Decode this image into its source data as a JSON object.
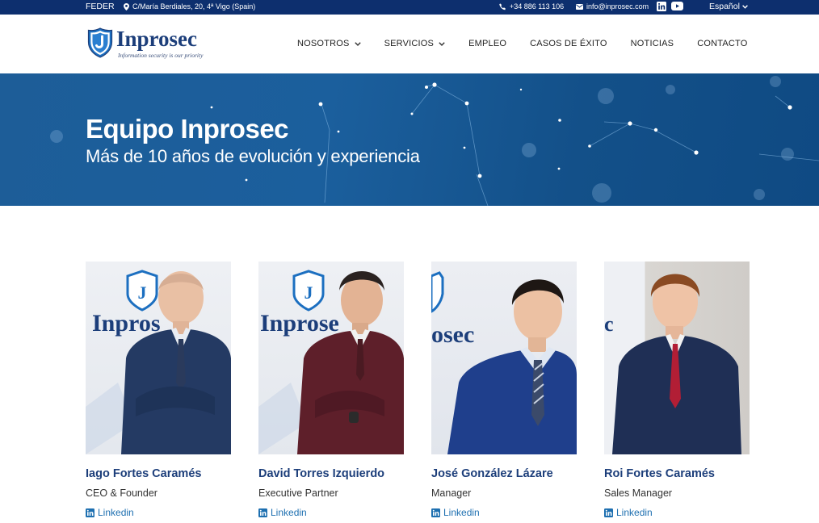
{
  "topbar": {
    "feder": "FEDER",
    "address": "C/María Berdiales, 20, 4ª Vigo (Spain)",
    "phone": "+34 886 113 106",
    "email": "info@inprosec.com",
    "language": "Español"
  },
  "header": {
    "brand": "Inprosec",
    "tagline": "Information security is our priority",
    "nav": [
      {
        "label": "NOSOTROS"
      },
      {
        "label": "SERVICIOS"
      },
      {
        "label": "EMPLEO"
      },
      {
        "label": "CASOS DE ÉXITO"
      },
      {
        "label": "NOTICIAS"
      },
      {
        "label": "CONTACTO"
      }
    ]
  },
  "hero": {
    "title": "Equipo Inprosec",
    "subtitle": "Más de 10 años de evolución y experiencia"
  },
  "team": [
    {
      "name": "Iago Fortes Caramés",
      "role": "CEO & Founder",
      "link": "Linkedin",
      "banner_text": "Inpros",
      "tie_color": "#2a3a5c"
    },
    {
      "name": "David Torres Izquierdo",
      "role": "Executive Partner",
      "link": "Linkedin",
      "banner_text": "Inprose",
      "tie_color": "#5a1e26"
    },
    {
      "name": "José González Lázare",
      "role": "Manager",
      "link": "Linkedin",
      "banner_text": "osec",
      "tie_color": "#3b4a6a"
    },
    {
      "name": "Roi Fortes Caramés",
      "role": "Sales Manager",
      "link": "Linkedin",
      "banner_text": "c",
      "tie_color": "#b21e35"
    }
  ],
  "colors": {
    "topbar": "#0d2f6e",
    "brand_blue": "#1c3e7a",
    "link_blue": "#1d6fb0"
  }
}
